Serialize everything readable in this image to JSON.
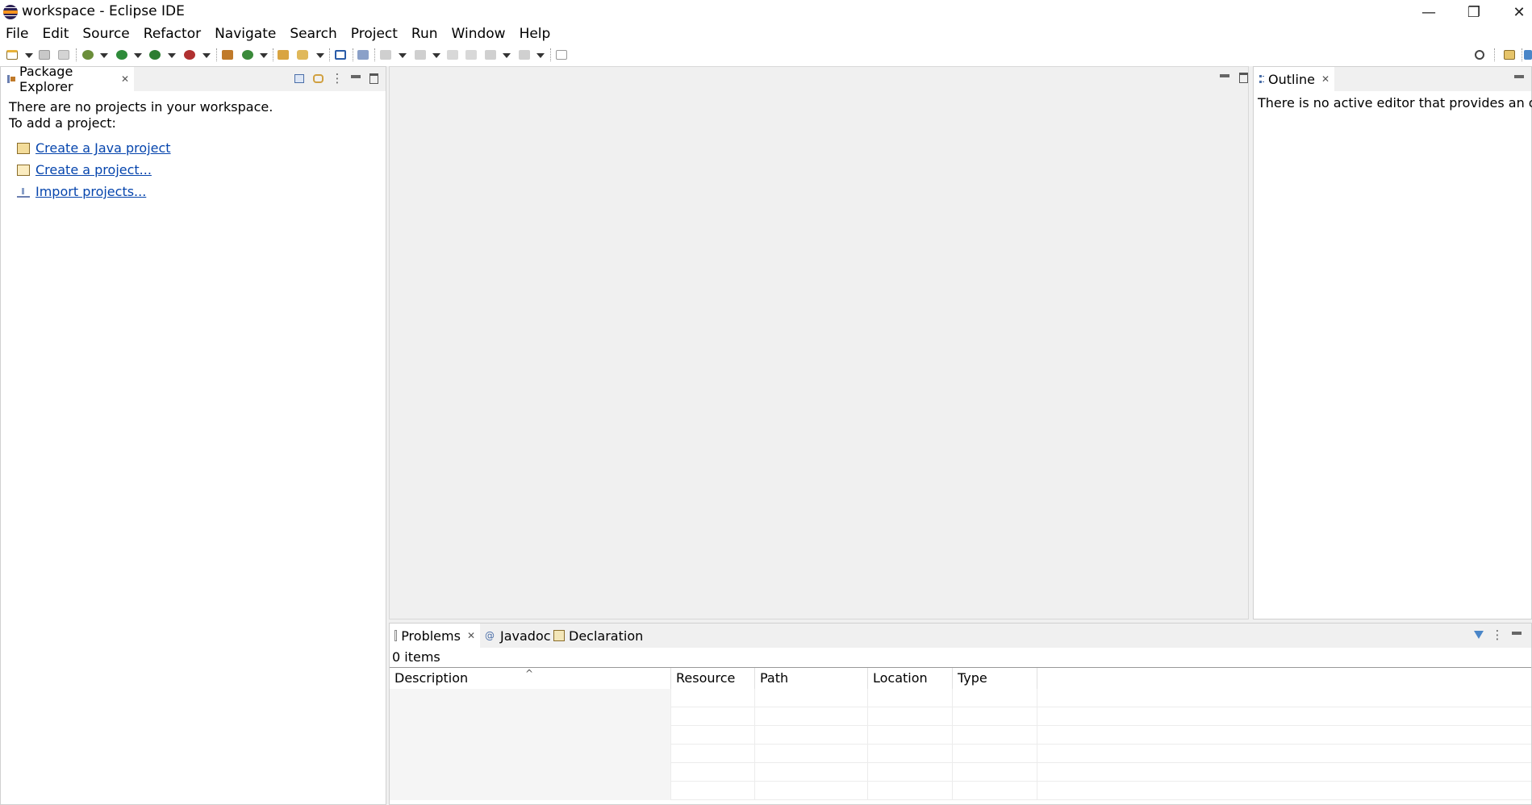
{
  "window": {
    "title": "workspace - Eclipse IDE",
    "minimize_glyph": "—",
    "maximize_glyph": "❐",
    "close_glyph": "✕"
  },
  "menu": [
    "File",
    "Edit",
    "Source",
    "Refactor",
    "Navigate",
    "Search",
    "Project",
    "Run",
    "Window",
    "Help"
  ],
  "package_explorer": {
    "tab_label": "Package Explorer",
    "message_line1": "There are no projects in your workspace.",
    "message_line2": "To add a project:",
    "links": [
      {
        "label": "Create a Java project",
        "icon": "new-java-project-icon"
      },
      {
        "label": "Create a project...",
        "icon": "new-project-icon"
      },
      {
        "label": "Import projects...",
        "icon": "import-icon"
      }
    ]
  },
  "outline": {
    "tab_label": "Outline",
    "message": "There is no active editor that provides an outline."
  },
  "bottom_panel": {
    "tabs": [
      {
        "label": "Problems",
        "icon": "problems-icon"
      },
      {
        "label": "Javadoc",
        "icon": "javadoc-icon"
      },
      {
        "label": "Declaration",
        "icon": "declaration-icon"
      }
    ],
    "item_count": "0 items",
    "columns": [
      "Description",
      "Resource",
      "Path",
      "Location",
      "Type"
    ]
  },
  "colors": {
    "link": "#0645ad",
    "panel_bg": "#f0f0f0",
    "eclipse_purple": "#2c2255",
    "eclipse_orange": "#f7941e"
  }
}
